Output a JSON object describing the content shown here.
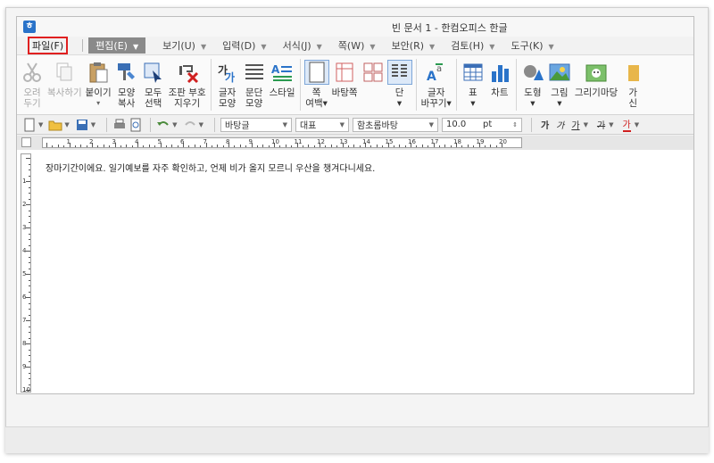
{
  "window": {
    "title": "빈 문서 1 - 한컴오피스 한글",
    "app_icon_letter": "ㅎ"
  },
  "menu": {
    "file": "파일(F)",
    "edit": "편집(E)",
    "items": [
      {
        "id": "view",
        "label": "보기(U)"
      },
      {
        "id": "input",
        "label": "입력(D)"
      },
      {
        "id": "format",
        "label": "서식(J)"
      },
      {
        "id": "page",
        "label": "쪽(W)"
      },
      {
        "id": "security",
        "label": "보안(R)"
      },
      {
        "id": "review",
        "label": "검토(H)"
      },
      {
        "id": "tools",
        "label": "도구(K)"
      }
    ]
  },
  "ribbon": {
    "cut": "오려\n두기",
    "copy": "복사하기",
    "paste": "붙이기",
    "paste_caret": "▾",
    "format_copy": "모양\n복사",
    "select_all": "모두\n선택",
    "remove_symbol": "조판 부호\n지우기",
    "char_shape": "글자\n모양",
    "para_shape": "문단\n모양",
    "style": "스타일",
    "page_margin": "쪽\n여백▾",
    "page_bg": "바탕쪽",
    "column": "단\n▾",
    "char_change": "글자\n바꾸기▾",
    "table": "표\n▾",
    "chart": "차트",
    "shape": "도형\n▾",
    "picture": "그림\n▾",
    "draw": "그리기마당",
    "more": "가\n신"
  },
  "format_bar": {
    "style_combo": "바탕글",
    "lang_combo": "대표",
    "font_combo": "함초롬바탕",
    "size_combo": "10.0",
    "size_unit": "pt",
    "bold": "가",
    "italic": "가",
    "underline": "가",
    "strike": "가",
    "font_color": "가"
  },
  "ruler": {
    "numbers": [
      "1",
      "2",
      "3",
      "4",
      "5",
      "6",
      "7",
      "8",
      "9",
      "10",
      "11",
      "12",
      "13",
      "14",
      "15",
      "16",
      "17",
      "18",
      "19",
      "20"
    ],
    "vnumbers": [
      "1",
      "2",
      "3",
      "4",
      "5",
      "6",
      "7",
      "8",
      "9",
      "10"
    ]
  },
  "document": {
    "text": "장마기간이에요. 일기예보를 자주 확인하고, 언제 비가 올지 모르니 우산을 챙겨다니세요."
  },
  "colors": {
    "accent_blue": "#2a73c9",
    "file_highlight": "#e02020",
    "edit_tab_bg": "#8a8a8a"
  }
}
